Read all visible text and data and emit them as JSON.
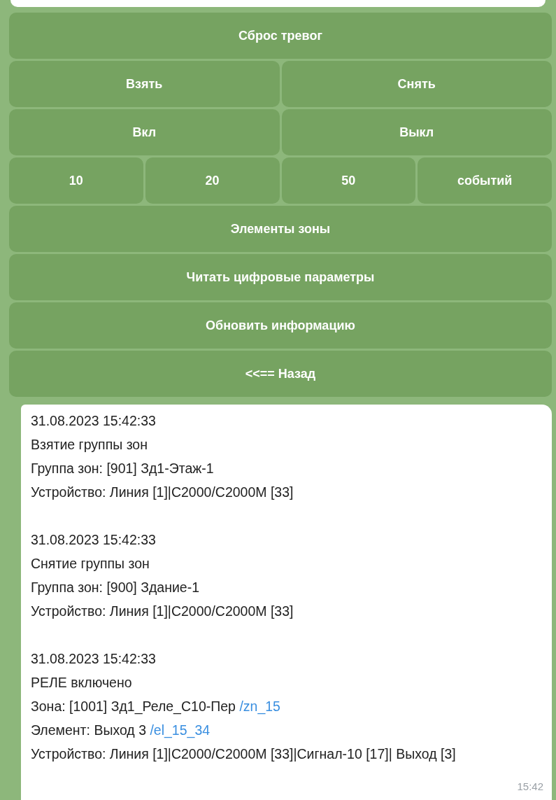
{
  "keyboard": {
    "rows": [
      [
        "Сброс тревог"
      ],
      [
        "Взять",
        "Снять"
      ],
      [
        "Вкл",
        "Выкл"
      ],
      [
        "10",
        "20",
        "50",
        "событий"
      ],
      [
        "Элементы зоны"
      ],
      [
        "Читать цифровые параметры"
      ],
      [
        "Обновить информацию"
      ],
      [
        "<<== Назад"
      ]
    ]
  },
  "message": {
    "events": [
      {
        "lines": [
          {
            "text": "31.08.2023 15:42:33"
          },
          {
            "text": "Взятие группы зон"
          },
          {
            "text": "Группа зон: [901] Зд1-Этаж-1"
          },
          {
            "text": "Устройство: Линия [1]|C2000/C2000M [33]"
          }
        ]
      },
      {
        "lines": [
          {
            "text": "31.08.2023 15:42:33"
          },
          {
            "text": "Снятие группы зон"
          },
          {
            "text": "Группа зон: [900] Здание-1"
          },
          {
            "text": "Устройство: Линия [1]|C2000/C2000M [33]"
          }
        ]
      },
      {
        "lines": [
          {
            "text": "31.08.2023 15:42:33"
          },
          {
            "text": "РЕЛЕ включено"
          },
          {
            "text": "Зона: [1001] Зд1_Реле_С10-Пер",
            "link": "/zn_15"
          },
          {
            "text": "Элемент: Выход 3",
            "link": "/el_15_34"
          },
          {
            "text": "Устройство: Линия [1]|C2000/C2000M [33]|Сигнал-10 [17]| Выход [3]"
          }
        ]
      }
    ],
    "time": "15:42"
  }
}
